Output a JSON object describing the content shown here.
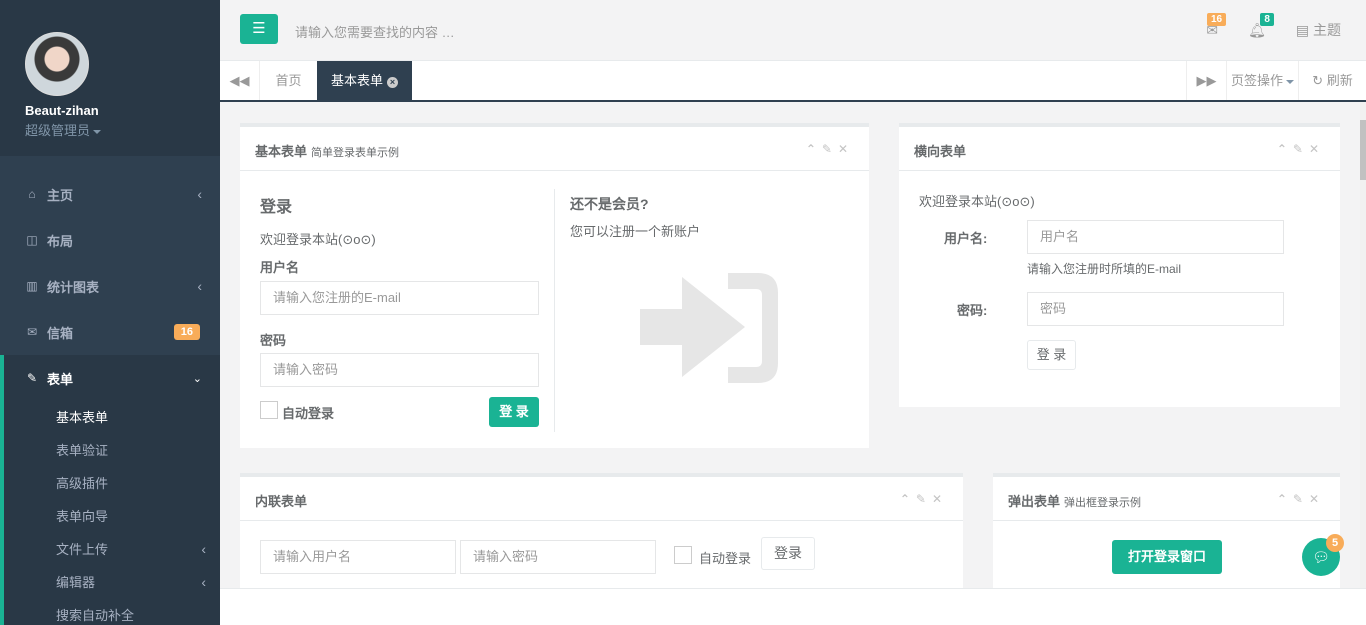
{
  "sidebar": {
    "user_name": "Beaut-zihan",
    "user_role": "超级管理员",
    "items": [
      {
        "label": "主页",
        "icon": "home-icon"
      },
      {
        "label": "布局",
        "icon": "columns-icon"
      },
      {
        "label": "统计图表",
        "icon": "bar-chart-icon"
      },
      {
        "label": "信箱",
        "icon": "envelope-icon",
        "badge": "16"
      },
      {
        "label": "表单",
        "icon": "edit-icon"
      }
    ],
    "sub_items": [
      "基本表单",
      "表单验证",
      "高级插件",
      "表单向导",
      "文件上传",
      "编辑器",
      "搜索自动补全"
    ]
  },
  "topbar": {
    "search_placeholder": "请输入您需要查找的内容 …",
    "mail_count": "16",
    "bell_count": "8",
    "theme_label": "主题"
  },
  "tabs": {
    "items": [
      "首页",
      "基本表单"
    ],
    "page_ops": "页签操作",
    "refresh": "刷新"
  },
  "basic_form": {
    "title": "基本表单",
    "subtitle": "简单登录表单示例",
    "heading": "登录",
    "welcome": "欢迎登录本站(⊙o⊙)",
    "username_label": "用户名",
    "username_placeholder": "请输入您注册的E-mail",
    "password_label": "密码",
    "password_placeholder": "请输入密码",
    "remember": "自动登录",
    "login": "登 录",
    "register_title": "还不是会员?",
    "register_text": "您可以注册一个新账户"
  },
  "horizontal_form": {
    "title": "横向表单",
    "welcome": "欢迎登录本站(⊙o⊙)",
    "username_label": "用户名:",
    "username_placeholder": "用户名",
    "username_help": "请输入您注册时所填的E-mail",
    "password_label": "密码:",
    "password_placeholder": "密码",
    "login": "登 录"
  },
  "inline_form": {
    "title": "内联表单",
    "username_placeholder": "请输入用户名",
    "password_placeholder": "请输入密码",
    "remember": "自动登录",
    "login": "登录"
  },
  "modal_form": {
    "title": "弹出表单",
    "subtitle": "弹出框登录示例",
    "open_button": "打开登录窗口"
  },
  "chat": {
    "count": "5"
  },
  "colors": {
    "accent": "#1ab394",
    "sidebar": "#2f4050",
    "badge": "#f8ac59"
  }
}
